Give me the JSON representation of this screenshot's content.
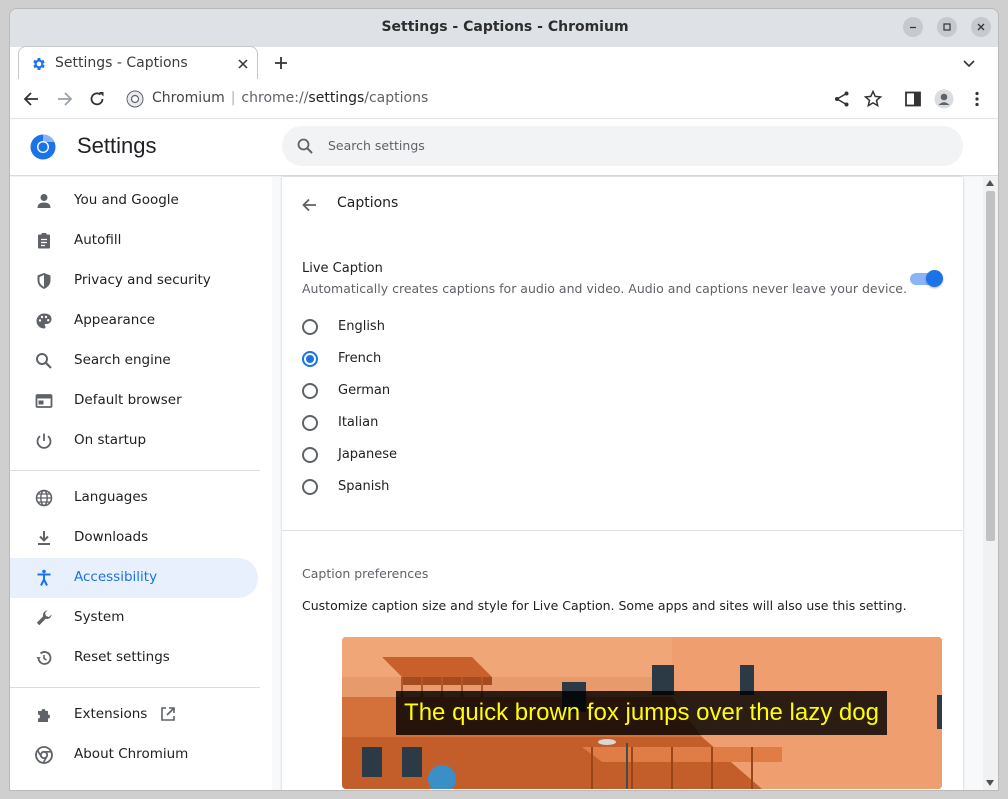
{
  "window": {
    "title": "Settings - Captions - Chromium"
  },
  "tab": {
    "title": "Settings - Captions"
  },
  "omnibox": {
    "site": "Chromium",
    "url_scheme": "chrome://",
    "url_host": "settings",
    "url_path": "/captions"
  },
  "settings": {
    "title": "Settings",
    "search_placeholder": "Search settings"
  },
  "sidebar": {
    "items": [
      {
        "label": "You and Google",
        "icon": "person-icon"
      },
      {
        "label": "Autofill",
        "icon": "clipboard-icon"
      },
      {
        "label": "Privacy and security",
        "icon": "shield-icon"
      },
      {
        "label": "Appearance",
        "icon": "palette-icon"
      },
      {
        "label": "Search engine",
        "icon": "search-icon"
      },
      {
        "label": "Default browser",
        "icon": "browser-icon"
      },
      {
        "label": "On startup",
        "icon": "power-icon"
      },
      {
        "label": "Languages",
        "icon": "globe-icon"
      },
      {
        "label": "Downloads",
        "icon": "download-icon"
      },
      {
        "label": "Accessibility",
        "icon": "accessibility-icon",
        "active": true
      },
      {
        "label": "System",
        "icon": "wrench-icon"
      },
      {
        "label": "Reset settings",
        "icon": "restore-icon"
      },
      {
        "label": "Extensions",
        "icon": "puzzle-icon"
      },
      {
        "label": "About Chromium",
        "icon": "chromium-icon"
      }
    ]
  },
  "captions": {
    "heading": "Captions",
    "live_caption_label": "Live Caption",
    "live_caption_desc": "Automatically creates captions for audio and video. Audio and captions never leave your device.",
    "live_caption_enabled": true,
    "languages": [
      "English",
      "French",
      "German",
      "Italian",
      "Japanese",
      "Spanish"
    ],
    "selected_language": "French",
    "prefs_heading": "Caption preferences",
    "prefs_desc": "Customize caption size and style for Live Caption. Some apps and sites will also use this setting.",
    "preview_caption": "The quick brown fox jumps over the lazy dog"
  },
  "colors": {
    "accent": "#1a73e8",
    "active_bg": "#e8f0fe",
    "caption_text": "#ffff00"
  }
}
